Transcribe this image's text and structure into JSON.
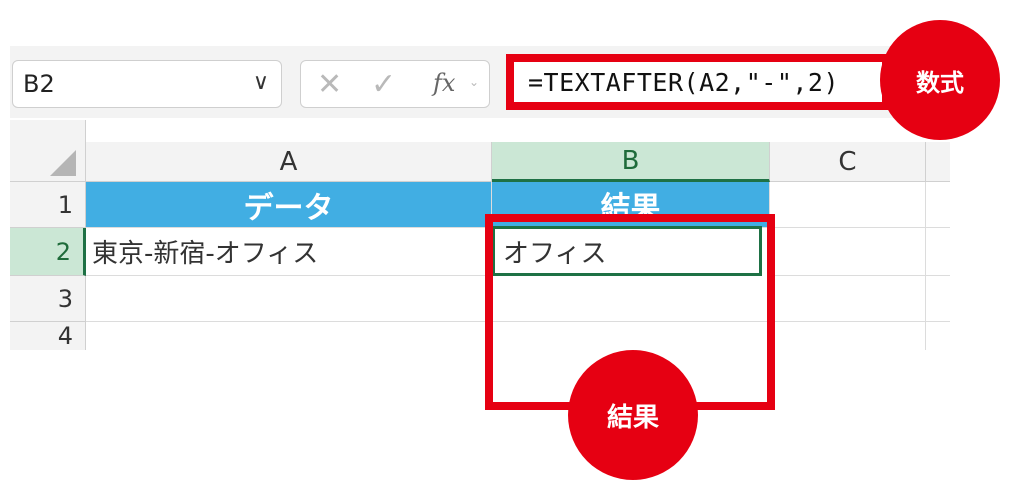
{
  "namebox": {
    "value": "B2",
    "chevron": "∨"
  },
  "formula_bar": {
    "cancel": "✕",
    "enter": "✓",
    "fx": "fx",
    "formula": "=TEXTAFTER(A2,\"-\",2)"
  },
  "columns": [
    "A",
    "B",
    "C"
  ],
  "rows": [
    "1",
    "2",
    "3",
    "4"
  ],
  "cells": {
    "A1": "データ",
    "B1": "結果",
    "A2": "東京-新宿-オフィス",
    "B2": "オフィス"
  },
  "callouts": {
    "formula": "数式",
    "result": "結果"
  },
  "colors": {
    "accent_red": "#e60012",
    "header_blue": "#41aee3",
    "selection_green": "#1e7145"
  }
}
